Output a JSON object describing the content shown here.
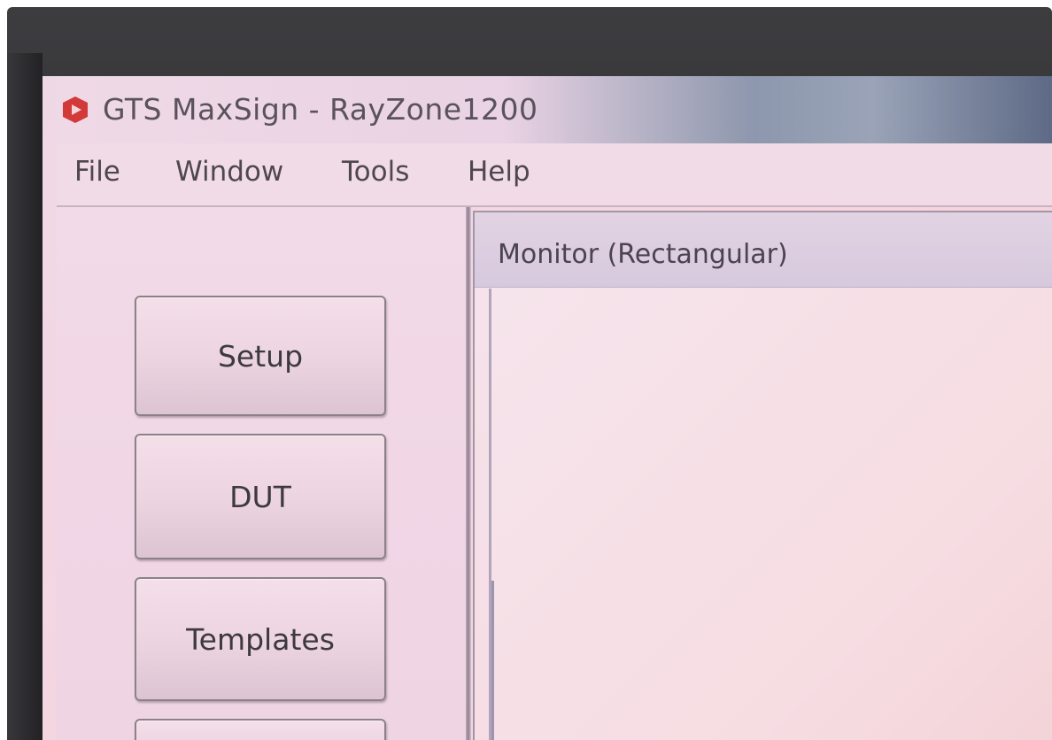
{
  "window": {
    "title": "GTS MaxSign - RayZone1200",
    "icon": "app-logo-icon",
    "icon_color": "#d23a3a"
  },
  "menu": {
    "items": [
      {
        "label": "File"
      },
      {
        "label": "Window"
      },
      {
        "label": "Tools"
      },
      {
        "label": "Help"
      }
    ]
  },
  "sidebar": {
    "buttons": [
      {
        "label": "Setup"
      },
      {
        "label": "DUT"
      },
      {
        "label": "Templates"
      },
      {
        "label": ""
      }
    ]
  },
  "monitor": {
    "title": "Monitor (Rectangular)"
  }
}
